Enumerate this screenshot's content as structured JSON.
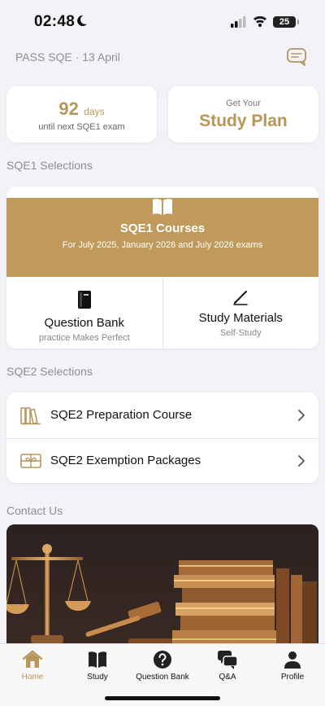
{
  "status": {
    "time": "02:48",
    "battery": "25"
  },
  "header": {
    "title": "PASS SQE · 13 April"
  },
  "countdown": {
    "days": "92",
    "unit": "days",
    "subtitle": "until next SQE1 exam"
  },
  "study_plan": {
    "top": "Get Your",
    "main": "Study Plan"
  },
  "sqe1": {
    "section_label": "SQE1 Selections",
    "courses_title": "SQE1 Courses",
    "courses_subtitle": "For July 2025, January 2026 and July 2026 exams",
    "question_bank": {
      "title": "Question Bank",
      "subtitle": "practice Makes Perfect"
    },
    "study_materials": {
      "title": "Study Materials",
      "subtitle": "Self-Study"
    }
  },
  "sqe2": {
    "section_label": "SQE2 Selections",
    "items": [
      {
        "label": "SQE2 Preparation Course",
        "icon": "books-icon"
      },
      {
        "label": "SQE2 Exemption Packages",
        "icon": "gift-card-icon"
      }
    ]
  },
  "contact": {
    "section_label": "Contact Us"
  },
  "tabbar": {
    "tabs": [
      {
        "label": "Home",
        "icon": "home-icon",
        "active": true
      },
      {
        "label": "Study",
        "icon": "book-icon"
      },
      {
        "label": "Question Bank",
        "icon": "question-icon"
      },
      {
        "label": "Q&A",
        "icon": "chat-bubbles-icon"
      },
      {
        "label": "Profile",
        "icon": "person-icon"
      }
    ]
  },
  "colors": {
    "accent": "#b8955a",
    "banner_gold": "#bf9a5a",
    "background": "#f2f2f7"
  }
}
